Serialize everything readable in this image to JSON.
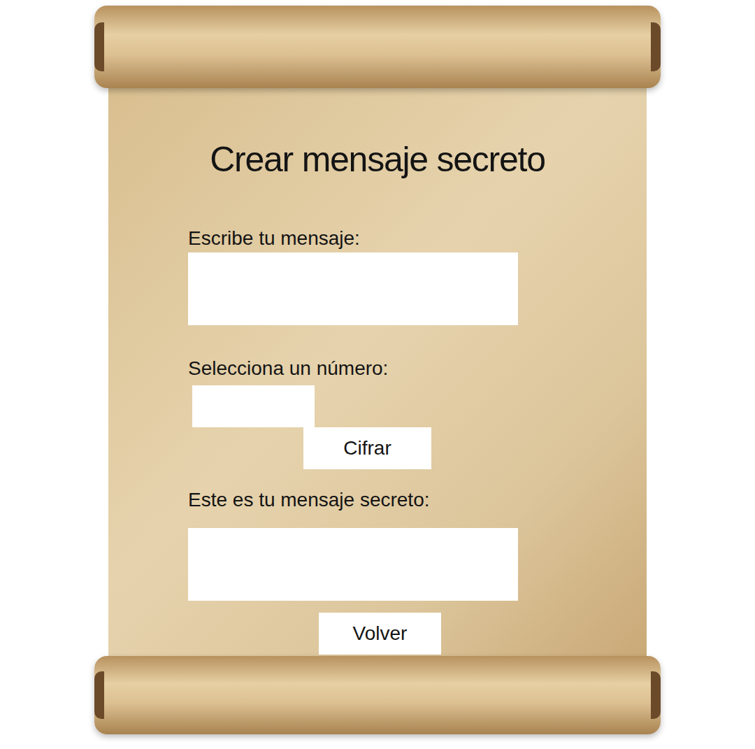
{
  "title": "Crear mensaje secreto",
  "message_field": {
    "label": "Escribe tu mensaje:",
    "value": ""
  },
  "number_field": {
    "label": "Selecciona un número:",
    "value": ""
  },
  "cipher_button": {
    "label": "Cifrar"
  },
  "result_field": {
    "label": "Este es tu mensaje secreto:",
    "value": ""
  },
  "back_button": {
    "label": "Volver"
  }
}
